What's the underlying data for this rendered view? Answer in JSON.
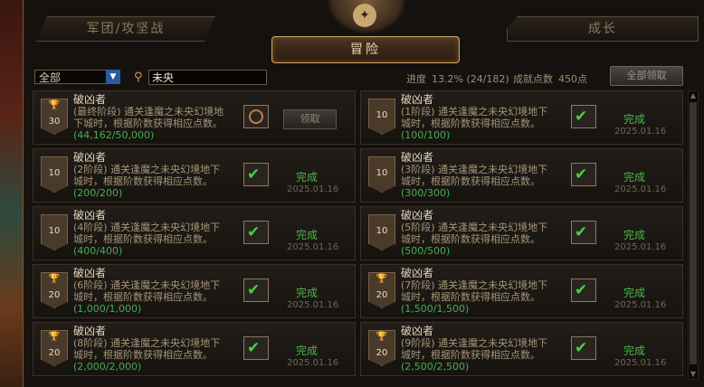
{
  "tabs": {
    "left": "军团/攻坚战",
    "right": "成长",
    "center": "冒险"
  },
  "filter": {
    "selected": "全部"
  },
  "search": {
    "value": "未央"
  },
  "progress": {
    "label": "进度",
    "value": "13.2% (24/182)"
  },
  "points": {
    "label": "成就点数",
    "value": "450点"
  },
  "claim_all_label": "全部领取",
  "cards": [
    {
      "medal": "30",
      "name": "破凶者",
      "stage": "(最终阶段)",
      "desc1": " 通关逢魔之未央幻境地",
      "desc2": "下城时，根据阶数获得相应点数。",
      "progress": "(44,162/50,000)",
      "state": "claim",
      "claim_label": "领取"
    },
    {
      "medal": "10",
      "name": "破凶者",
      "stage": "(1阶段)",
      "desc1": " 通关逢魔之未央幻境地下",
      "desc2": "城时，根据阶数获得相应点数。",
      "progress": "(100/100)",
      "state": "done",
      "done_label": "完成",
      "date": "2025.01.16"
    },
    {
      "medal": "10",
      "name": "破凶者",
      "stage": "(2阶段)",
      "desc1": " 通关逢魔之未央幻境地下",
      "desc2": "城时，根据阶数获得相应点数。",
      "progress": "(200/200)",
      "state": "done",
      "done_label": "完成",
      "date": "2025.01.16"
    },
    {
      "medal": "10",
      "name": "破凶者",
      "stage": "(3阶段)",
      "desc1": " 通关逢魔之未央幻境地下",
      "desc2": "城时，根据阶数获得相应点数。",
      "progress": "(300/300)",
      "state": "done",
      "done_label": "完成",
      "date": "2025.01.16"
    },
    {
      "medal": "10",
      "name": "破凶者",
      "stage": "(4阶段)",
      "desc1": " 通关逢魔之未央幻境地下",
      "desc2": "城时，根据阶数获得相应点数。",
      "progress": "(400/400)",
      "state": "done",
      "done_label": "完成",
      "date": "2025.01.16"
    },
    {
      "medal": "10",
      "name": "破凶者",
      "stage": "(5阶段)",
      "desc1": " 通关逢魔之未央幻境地下",
      "desc2": "城时，根据阶数获得相应点数。",
      "progress": "(500/500)",
      "state": "done",
      "done_label": "完成",
      "date": "2025.01.16"
    },
    {
      "medal": "20",
      "name": "破凶者",
      "stage": "(6阶段)",
      "desc1": " 通关逢魔之未央幻境地下",
      "desc2": "城时，根据阶数获得相应点数。",
      "progress": "(1,000/1,000)",
      "state": "done",
      "done_label": "完成",
      "date": "2025.01.16"
    },
    {
      "medal": "20",
      "name": "破凶者",
      "stage": "(7阶段)",
      "desc1": " 通关逢魔之未央幻境地下",
      "desc2": "城时，根据阶数获得相应点数。",
      "progress": "(1,500/1,500)",
      "state": "done",
      "done_label": "完成",
      "date": "2025.01.16"
    },
    {
      "medal": "20",
      "name": "破凶者",
      "stage": "(8阶段)",
      "desc1": " 通关逢魔之未央幻境地下",
      "desc2": "城时，根据阶数获得相应点数。",
      "progress": "(2,000/2,000)",
      "state": "done",
      "done_label": "完成",
      "date": "2025.01.16"
    },
    {
      "medal": "20",
      "name": "破凶者",
      "stage": "(9阶段)",
      "desc1": " 通关逢魔之未央幻境地下",
      "desc2": "城时，根据阶数获得相应点数。",
      "progress": "(2,500/2,500)",
      "state": "done",
      "done_label": "完成",
      "date": "2025.01.16"
    }
  ]
}
